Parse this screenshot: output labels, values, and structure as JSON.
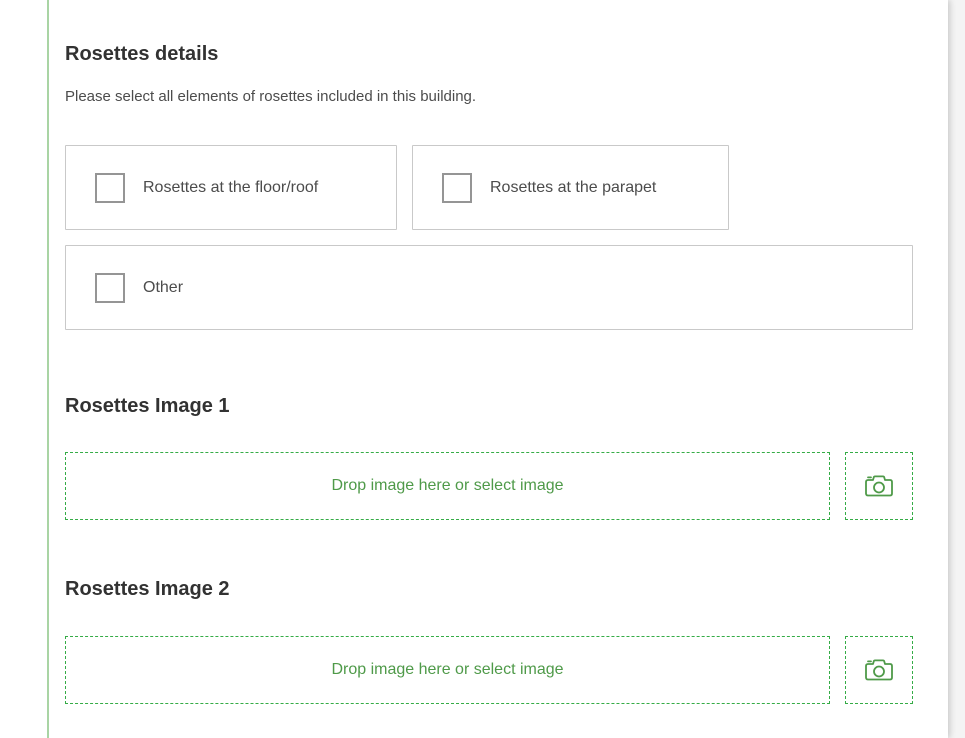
{
  "rosettes_details": {
    "title": "Rosettes details",
    "description": "Please select all elements of rosettes included in this building.",
    "options": [
      {
        "label": "Rosettes at the floor/roof",
        "checked": false
      },
      {
        "label": "Rosettes at the parapet",
        "checked": false
      },
      {
        "label": "Other",
        "checked": false
      }
    ]
  },
  "images": [
    {
      "title": "Rosettes Image 1",
      "dropzone_text": "Drop image here or select image",
      "camera_icon": "camera-icon"
    },
    {
      "title": "Rosettes Image 2",
      "dropzone_text": "Drop image here or select image",
      "camera_icon": "camera-icon"
    }
  ],
  "colors": {
    "accent_line": "#a9d4a4",
    "dropzone_border": "#35ac46",
    "dropzone_text": "#4f9a49",
    "checkbox_border": "#959595"
  }
}
